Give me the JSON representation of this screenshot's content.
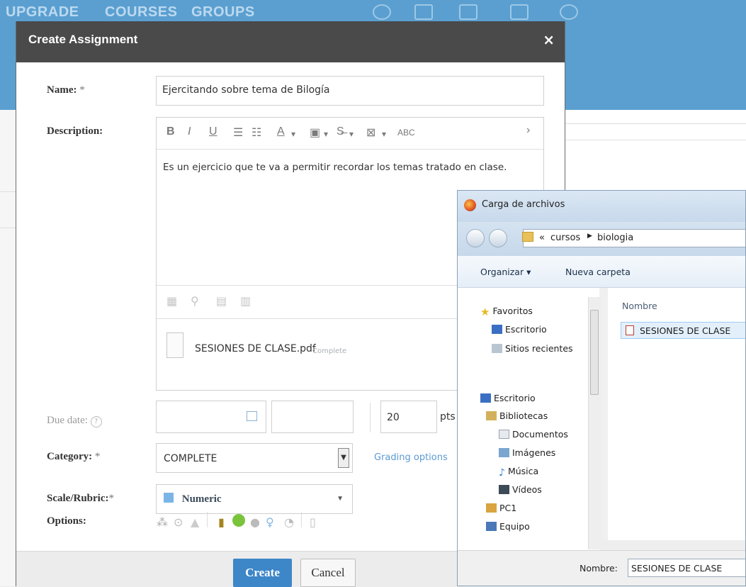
{
  "topnav": {
    "items": [
      "UPGRADE",
      "COURSES",
      "GROUPS"
    ]
  },
  "modal": {
    "title": "Create Assignment",
    "close": "×",
    "name": {
      "label": "Name:",
      "required": "*",
      "value": "Ejercitando sobre tema de Bilogía"
    },
    "description": {
      "label": "Description:",
      "text": "Es un ejercicio que te va a permitir recordar los temas tratado en clase.",
      "toolbar": [
        "B",
        "I",
        "U",
        "A",
        "ABC"
      ],
      "attachment": {
        "name": "SESIONES DE CLASE.pdf",
        "status": "Complete"
      }
    },
    "due_date": {
      "label": "Due date:",
      "help": "?",
      "points": "20",
      "points_unit": "pts"
    },
    "category": {
      "label": "Category:",
      "required": "*",
      "value": "COMPLETE",
      "grading_link": "Grading options"
    },
    "scale": {
      "label": "Scale/Rubric:",
      "required": "*",
      "value": "Numeric"
    },
    "options": {
      "label": "Options:"
    },
    "buttons": {
      "create": "Create",
      "cancel": "Cancel"
    }
  },
  "file_dialog": {
    "title": "Carga de archivos",
    "path": {
      "prefix": "«",
      "parts": [
        "cursos",
        "biologia"
      ]
    },
    "commands": {
      "organize": "Organizar",
      "new_folder": "Nueva carpeta"
    },
    "nav": {
      "favorites": "Favoritos",
      "fav_items": [
        "Escritorio",
        "Sitios recientes"
      ],
      "desktop": "Escritorio",
      "libraries": "Bibliotecas",
      "lib_items": [
        "Documentos",
        "Imágenes",
        "Música",
        "Vídeos"
      ],
      "pc": "PC1",
      "computer": "Equipo"
    },
    "column_name": "Nombre",
    "file": "SESIONES DE CLASE",
    "filename_label": "Nombre:",
    "filename_value": "SESIONES DE CLASE"
  }
}
